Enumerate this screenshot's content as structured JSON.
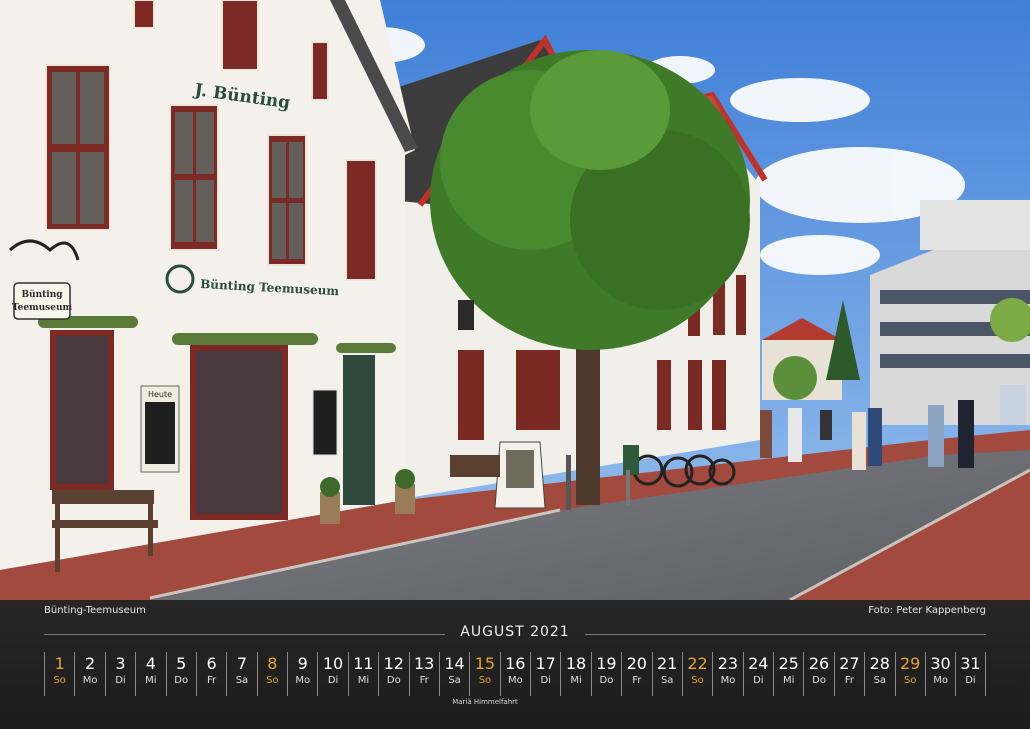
{
  "photo": {
    "description_shop_sign": "J. Bünting",
    "museum_sign": "Bünting Teemuseum",
    "hanging_sign": "Bünting Teemuseum",
    "board_heute": "Heute"
  },
  "calendar": {
    "caption_left": "Bünting-Teemuseum",
    "caption_right": "Foto: Peter Kappenberg",
    "month": "AUGUST 2021",
    "holiday_note": "Mariä Himmelfahrt",
    "days": [
      {
        "n": "1",
        "w": "So",
        "sun": true
      },
      {
        "n": "2",
        "w": "Mo"
      },
      {
        "n": "3",
        "w": "Di"
      },
      {
        "n": "4",
        "w": "Mi"
      },
      {
        "n": "5",
        "w": "Do"
      },
      {
        "n": "6",
        "w": "Fr"
      },
      {
        "n": "7",
        "w": "Sa"
      },
      {
        "n": "8",
        "w": "So",
        "sun": true
      },
      {
        "n": "9",
        "w": "Mo"
      },
      {
        "n": "10",
        "w": "Di"
      },
      {
        "n": "11",
        "w": "Mi"
      },
      {
        "n": "12",
        "w": "Do"
      },
      {
        "n": "13",
        "w": "Fr"
      },
      {
        "n": "14",
        "w": "Sa"
      },
      {
        "n": "15",
        "w": "So",
        "sun": true
      },
      {
        "n": "16",
        "w": "Mo"
      },
      {
        "n": "17",
        "w": "Di"
      },
      {
        "n": "18",
        "w": "Mi"
      },
      {
        "n": "19",
        "w": "Do"
      },
      {
        "n": "20",
        "w": "Fr"
      },
      {
        "n": "21",
        "w": "Sa"
      },
      {
        "n": "22",
        "w": "So",
        "sun": true
      },
      {
        "n": "23",
        "w": "Mo"
      },
      {
        "n": "24",
        "w": "Di"
      },
      {
        "n": "25",
        "w": "Mi"
      },
      {
        "n": "26",
        "w": "Do"
      },
      {
        "n": "27",
        "w": "Fr"
      },
      {
        "n": "28",
        "w": "Sa"
      },
      {
        "n": "29",
        "w": "So",
        "sun": true
      },
      {
        "n": "30",
        "w": "Mo"
      },
      {
        "n": "31",
        "w": "Di"
      }
    ]
  }
}
